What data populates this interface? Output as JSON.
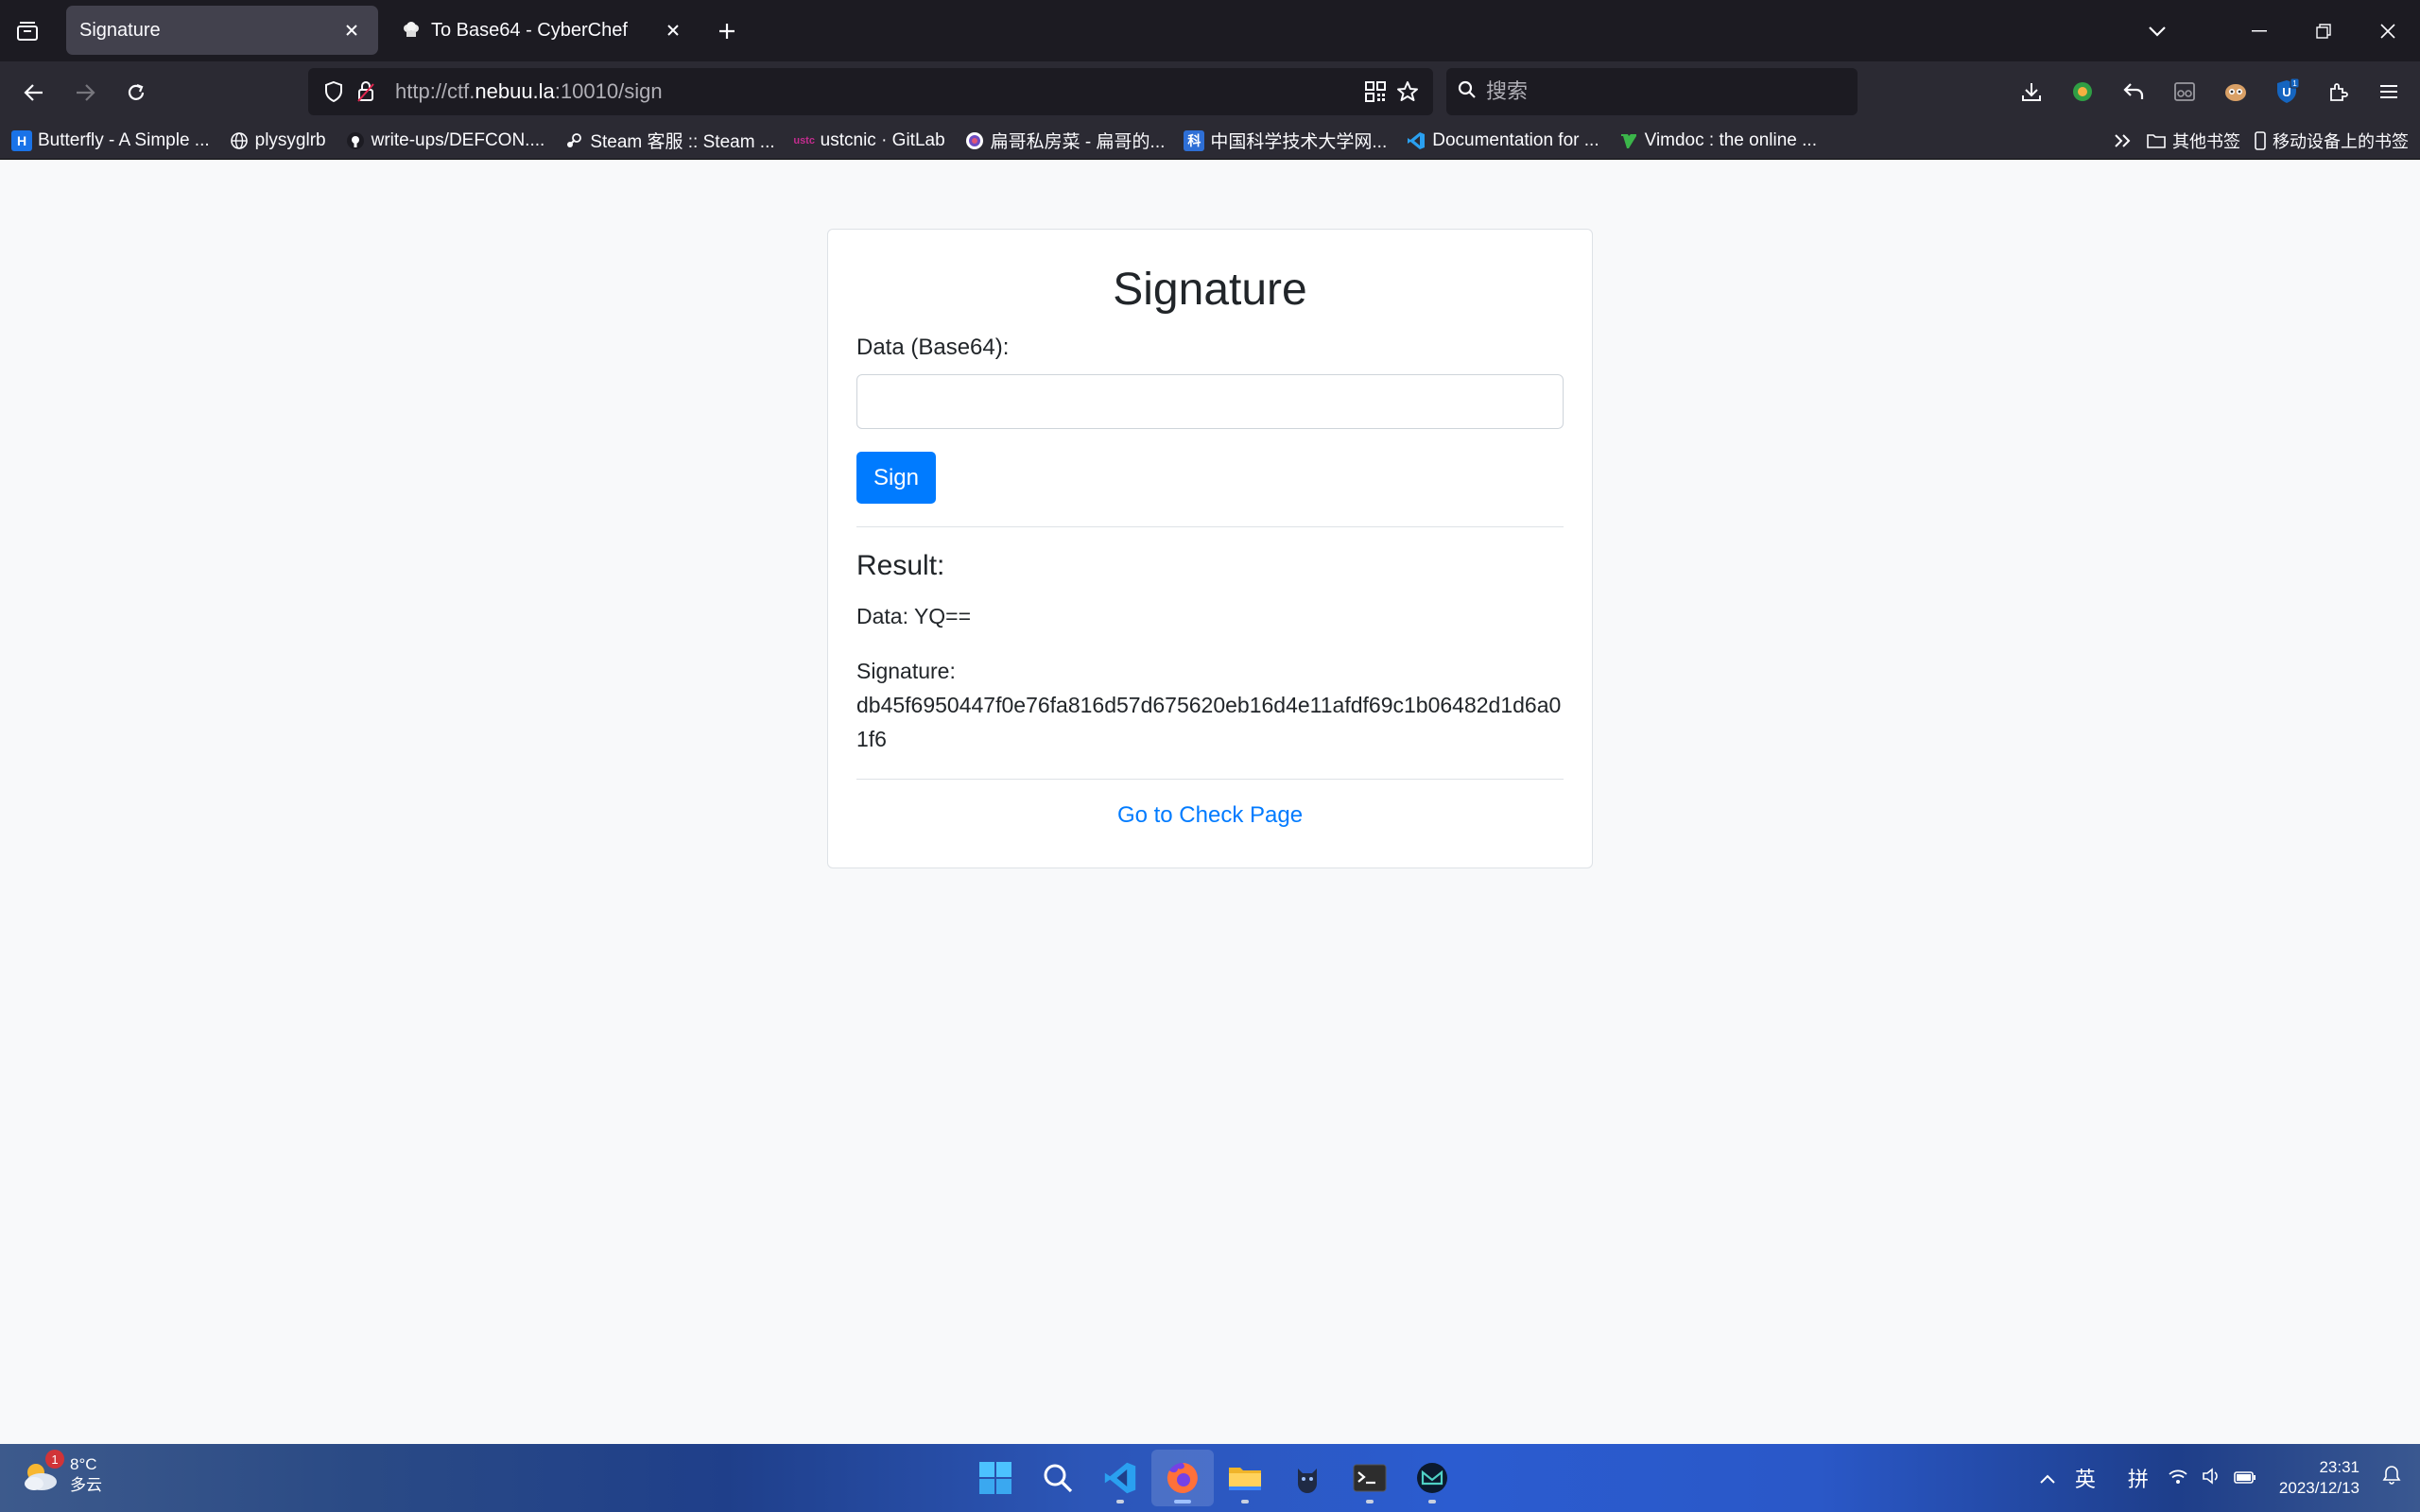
{
  "browser": {
    "tabs": [
      {
        "title": "Signature",
        "active": true
      },
      {
        "title": "To Base64 - CyberChef",
        "active": false
      }
    ],
    "url": {
      "host_prefix": "http://ctf.",
      "host_main": "nebuu.la",
      "rest": ":10010/sign"
    },
    "search_placeholder": "搜索",
    "bookmarks": [
      {
        "label": "Butterfly - A Simple ...",
        "icon": "H",
        "color": "#1a73e8"
      },
      {
        "label": "plysyglrb",
        "icon": "globe",
        "color": "#fbfbfe"
      },
      {
        "label": "write-ups/DEFCON....",
        "icon": "github",
        "color": "#fbfbfe"
      },
      {
        "label": "Steam 客服 :: Steam ...",
        "icon": "steam",
        "color": "#fbfbfe"
      },
      {
        "label": "ustcnic · GitLab",
        "icon": "ustc",
        "color": "#c42c8f"
      },
      {
        "label": "扁哥私房菜 - 扁哥的...",
        "icon": "blog",
        "color": "#6c4cc2"
      },
      {
        "label": "中国科学技术大学网...",
        "icon": "科",
        "color": "#2e6fd6"
      },
      {
        "label": "Documentation for ...",
        "icon": "vscode",
        "color": "#2aa0f0"
      },
      {
        "label": "Vimdoc : the online ...",
        "icon": "vim",
        "color": "#3bb54a"
      }
    ],
    "bookmarks_right": [
      {
        "label": "其他书签"
      },
      {
        "label": "移动设备上的书签"
      }
    ]
  },
  "page": {
    "title": "Signature",
    "data_label": "Data (Base64):",
    "data_value": "",
    "sign_button": "Sign",
    "result_heading": "Result:",
    "result_data_label": "Data: YQ==",
    "signature_label": "Signature:",
    "signature_value": "db45f6950447f0e76fa816d57d675620eb16d4e11afdf69c1b06482d1d6a01f6",
    "check_link": "Go to Check Page"
  },
  "taskbar": {
    "weather_temp": "8°C",
    "weather_desc": "多云",
    "weather_badge": "1",
    "ime_lang": "英",
    "ime_mode": "拼",
    "time": "23:31",
    "date": "2023/12/13"
  },
  "colors": {
    "primary": "#007bff",
    "chrome_dark": "#1c1b22",
    "chrome": "#2b2a33"
  }
}
